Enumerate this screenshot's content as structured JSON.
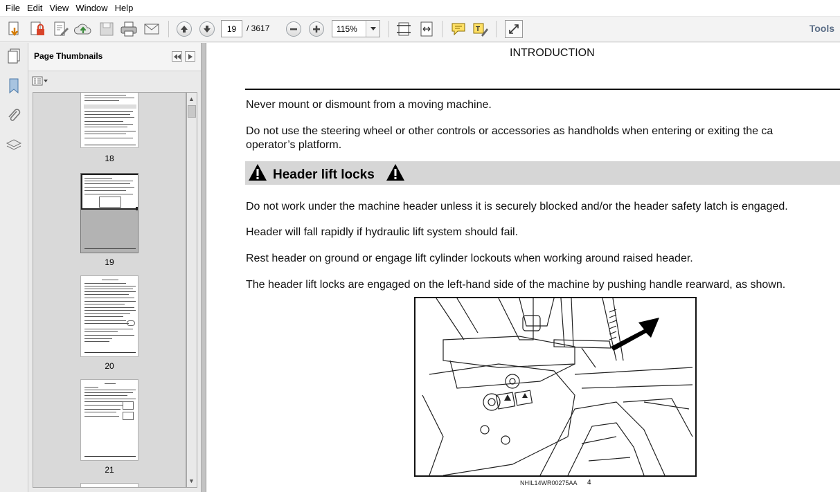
{
  "menu": [
    "File",
    "Edit",
    "View",
    "Window",
    "Help"
  ],
  "toolbar": {
    "page_current": "19",
    "page_total": "/ 3617",
    "zoom": "115%",
    "tools_label": "Tools",
    "icons": [
      "create-icon",
      "secure-icon",
      "sign-icon",
      "upload-icon",
      "save-icon",
      "print-icon",
      "email-icon",
      "prev-page-icon",
      "next-page-icon",
      "zoom-out-icon",
      "zoom-in-icon",
      "fit-page-icon",
      "fit-width-icon",
      "comment-icon",
      "highlight-icon",
      "expand-icon"
    ]
  },
  "side_panel": {
    "title": "Page Thumbnails",
    "thumbnails": [
      {
        "label": "18"
      },
      {
        "label": "19"
      },
      {
        "label": "20"
      },
      {
        "label": "21"
      }
    ],
    "icons": [
      "pages-icon",
      "bookmark-icon",
      "attachment-icon",
      "layers-icon",
      "thumbnail-options-icon"
    ]
  },
  "document": {
    "heading": "INTRODUCTION",
    "para1": "Never mount or dismount from a moving machine.",
    "para2_line1": "Do not use the steering wheel or other controls or accessories as handholds when entering or exiting the ca",
    "para2_line2": "operator’s platform.",
    "section_title": "Header lift locks",
    "para3": "Do not work under the machine header unless it is securely blocked and/or the header safety latch is engaged.",
    "para4": "Header will fall rapidly if hydraulic lift system should fail.",
    "para5": "Rest header on ground or engage lift cylinder lockouts when working around raised header.",
    "para6": "The header lift locks are engaged on the left-hand side of the machine by pushing handle rearward, as shown.",
    "figure_caption": "NHIL14WR00275AA",
    "figure_number": "4"
  }
}
